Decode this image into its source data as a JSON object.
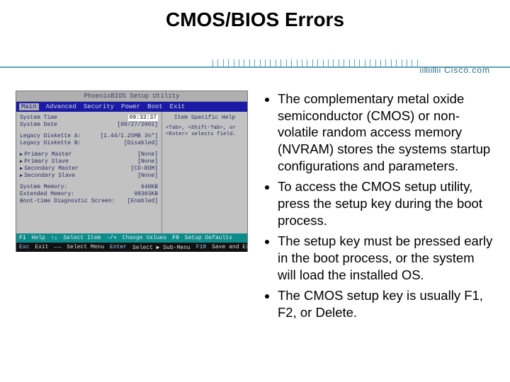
{
  "title": "CMOS/BIOS Errors",
  "brand": "Cisco.com",
  "bios": {
    "window_title": "PhoenixBIOS Setup Utility",
    "menu": [
      "Main",
      "Advanced",
      "Security",
      "Power",
      "Boot",
      "Exit"
    ],
    "menu_selected": "Main",
    "left": {
      "time_label": "System Time",
      "time_value": "09:33:37",
      "date_label": "System Date",
      "date_value": "[08/27/2002]",
      "disk_a_label": "Legacy Diskette A:",
      "disk_a_value": "[1.44/1.25MB 3½\"]",
      "disk_b_label": "Legacy Diskette B:",
      "disk_b_value": "[Disabled]",
      "pm_label": "Primary Master",
      "pm_value": "[None]",
      "ps_label": "Primary Slave",
      "ps_value": "[None]",
      "sm_label": "Secondary Master",
      "sm_value": "[CD-ROM]",
      "ss_label": "Secondary Slave",
      "ss_value": "[None]",
      "mem_label": "System Memory:",
      "mem_value": "640KB",
      "ext_label": "Extended Memory:",
      "ext_value": "98303KB",
      "diag_label": "Boot-time Diagnostic Screen:",
      "diag_value": "[Enabled]"
    },
    "help": {
      "title": "Item Specific Help",
      "body": "<Tab>, <Shift-Tab>, or <Enter> selects field."
    },
    "footer1": {
      "f1": "F1",
      "f1t": "Help",
      "arr": "↑↓",
      "arrt": "Select Item",
      "pm": "-/+",
      "pmt": "Change Values",
      "f9": "F9",
      "f9t": "Setup Defaults"
    },
    "footer2": {
      "esc": "Esc",
      "esct": "Exit",
      "lr": "←→",
      "lrt": "Select Menu",
      "ent": "Enter",
      "entt": "Select ▶ Sub-Menu",
      "f10": "F10",
      "f10t": "Save and Exit"
    }
  },
  "bullets": [
    "The complementary metal oxide semiconductor (CMOS) or non-volatile random access memory (NVRAM) stores the systems startup configurations and parameters.",
    "To access the CMOS setup utility, press the setup key during the boot process.",
    "The setup key must be pressed early in the boot process, or the system will load the installed OS.",
    "The CMOS setup key is usually F1, F2, or Delete."
  ]
}
